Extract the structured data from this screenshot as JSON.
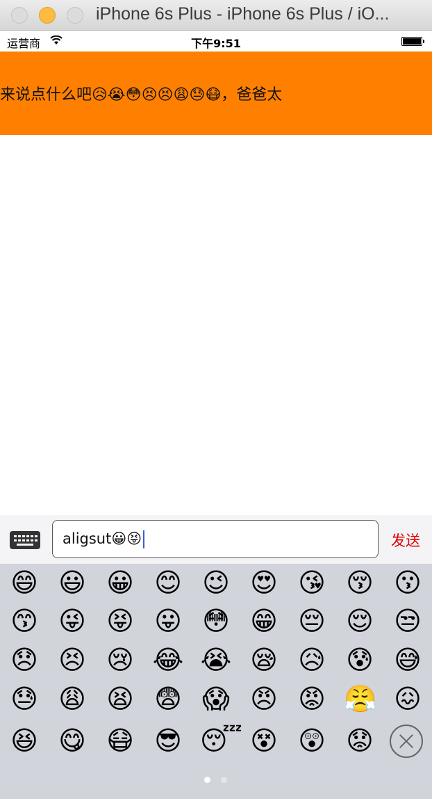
{
  "window": {
    "title": "iPhone 6s Plus - iPhone 6s Plus / iO..."
  },
  "status_bar": {
    "carrier": "运营商",
    "time": "下午9:51"
  },
  "banner": {
    "message": "来说点什么吧😥😭😳😣😣😩😓😷，爸爸太",
    "background": "#ff8000"
  },
  "composer": {
    "input_value": "aligsut😀😝",
    "send_label": "发送",
    "send_color": "#e00000",
    "keyboard_icon": "keyboard-icon"
  },
  "emoji_keyboard": {
    "rows": [
      [
        "😄",
        "😃",
        "😀",
        "😊",
        "😉",
        "😍",
        "😘",
        "😚",
        "😗"
      ],
      [
        "😙",
        "😜",
        "😝",
        "😛",
        "😳",
        "😁",
        "😔",
        "😌",
        "😒"
      ],
      [
        "😞",
        "😣",
        "😢",
        "😂",
        "😭",
        "😪",
        "😥",
        "😰",
        "😅"
      ],
      [
        "😓",
        "😩",
        "😫",
        "😨",
        "😱",
        "😠",
        "😡",
        "😤",
        "😖"
      ],
      [
        "😆",
        "😋",
        "😷",
        "😎",
        "😴",
        "😵",
        "😲",
        "😟"
      ]
    ],
    "delete_icon": "delete-icon",
    "pages": 2,
    "current_page": 1
  }
}
